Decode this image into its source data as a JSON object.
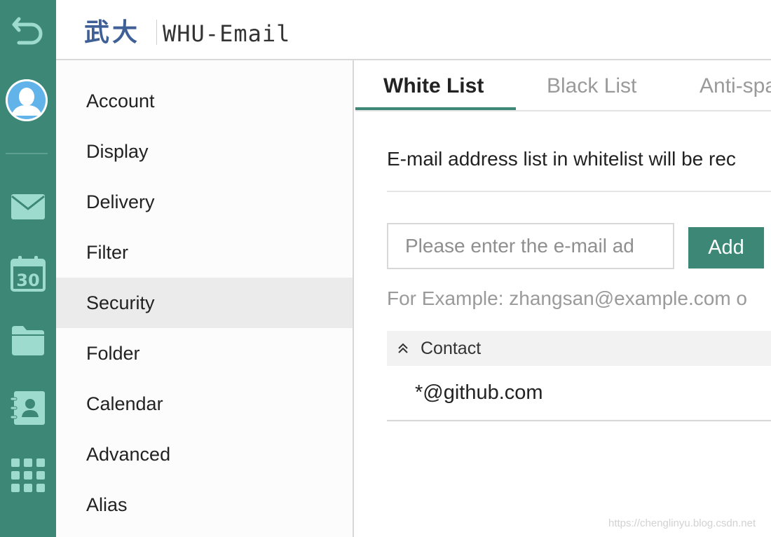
{
  "colors": {
    "accent": "#3c8775",
    "rail_icon": "#9ddbcf",
    "logo": "#3f5f97",
    "active_row": "#ebebeb"
  },
  "rail": {
    "icons": [
      "back-arrow-icon",
      "avatar-icon",
      "mail-icon",
      "calendar-icon",
      "folder-icon",
      "contacts-icon",
      "apps-grid-icon"
    ],
    "calendar_day": "30"
  },
  "header": {
    "logo_cn": "武大",
    "logo_en": "WHU-Email"
  },
  "nav": {
    "items": [
      {
        "label": "Account"
      },
      {
        "label": "Display"
      },
      {
        "label": "Delivery"
      },
      {
        "label": "Filter"
      },
      {
        "label": "Security",
        "active": true
      },
      {
        "label": "Folder"
      },
      {
        "label": "Calendar"
      },
      {
        "label": "Advanced"
      },
      {
        "label": "Alias"
      }
    ]
  },
  "tabs": [
    {
      "label": "White List",
      "active": true
    },
    {
      "label": "Black List"
    },
    {
      "label": "Anti-spa"
    }
  ],
  "main": {
    "description": "E-mail address list in whitelist will be rec",
    "input_placeholder": "Please enter the e-mail ad",
    "add_button": "Add",
    "example": "For Example: zhangsan@example.com o",
    "table": {
      "column": "Contact",
      "rows": [
        "*@github.com"
      ]
    }
  },
  "watermark": "https://chenglinyu.blog.csdn.net"
}
